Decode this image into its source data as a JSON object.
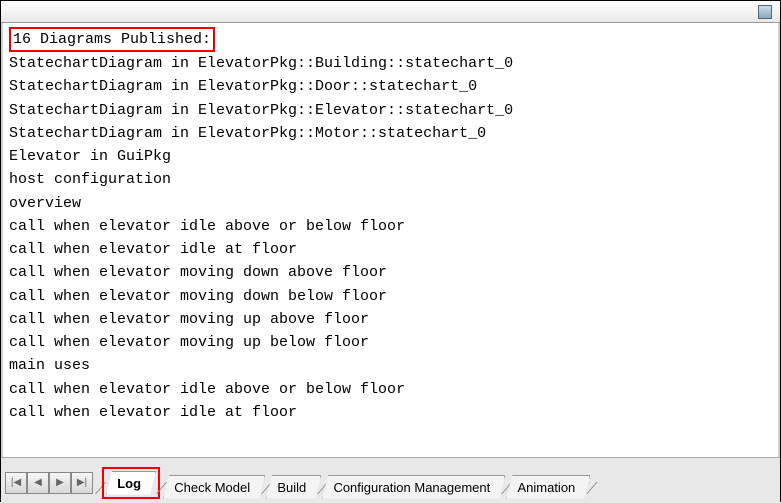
{
  "header_line": "16 Diagrams Published:",
  "log_lines": [
    "StatechartDiagram in ElevatorPkg::Building::statechart_0",
    "StatechartDiagram in ElevatorPkg::Door::statechart_0",
    "StatechartDiagram in ElevatorPkg::Elevator::statechart_0",
    "StatechartDiagram in ElevatorPkg::Motor::statechart_0",
    "Elevator in GuiPkg",
    "host configuration",
    "overview",
    "call when elevator idle above or below floor",
    "call when elevator idle at floor",
    "call when elevator moving down above floor",
    "call when elevator moving down below floor",
    "call when elevator moving up above floor",
    "call when elevator moving up below floor",
    "main uses",
    "call when elevator idle above or below floor",
    "call when elevator idle at floor"
  ],
  "nav": {
    "first": "|◀",
    "prev": "◀",
    "next": "▶",
    "last": "▶|"
  },
  "tabs": [
    {
      "id": "log",
      "label": "Log",
      "active": true,
      "highlighted": true
    },
    {
      "id": "check-model",
      "label": "Check Model",
      "active": false,
      "highlighted": false
    },
    {
      "id": "build",
      "label": "Build",
      "active": false,
      "highlighted": false
    },
    {
      "id": "config-mgmt",
      "label": "Configuration Management",
      "active": false,
      "highlighted": false
    },
    {
      "id": "animation",
      "label": "Animation",
      "active": false,
      "highlighted": false
    }
  ]
}
